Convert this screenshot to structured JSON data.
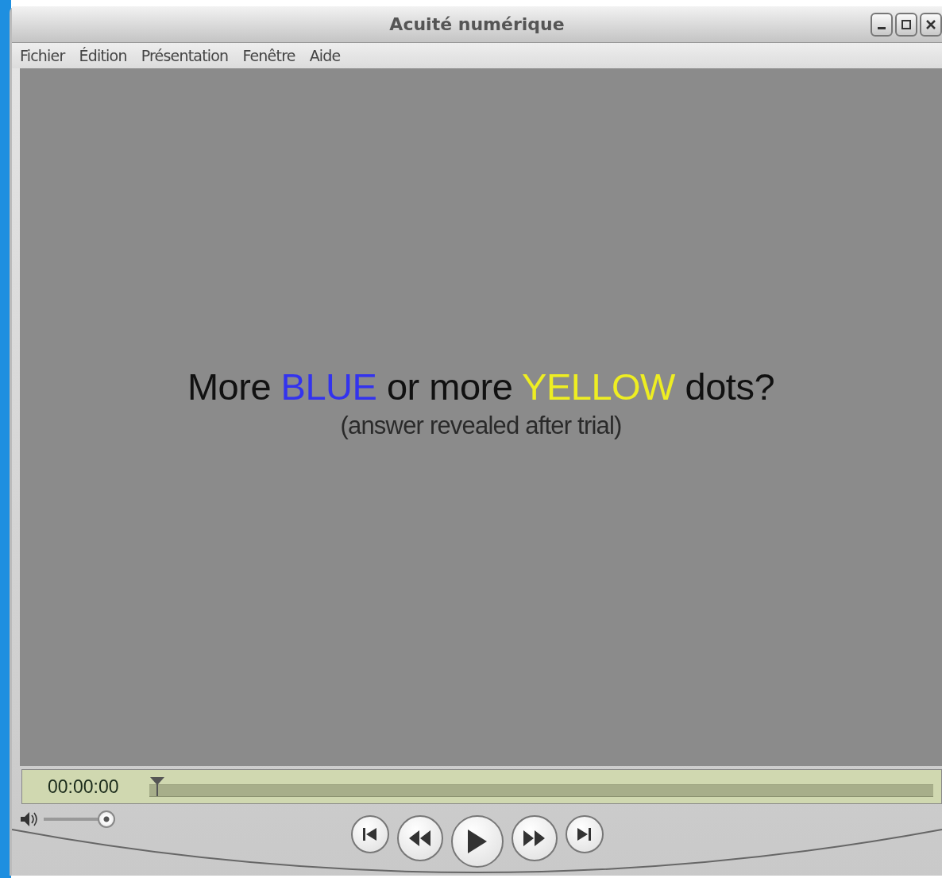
{
  "window": {
    "title": "Acuité numérique"
  },
  "menu": [
    {
      "label": "Fichier"
    },
    {
      "label": "Édition"
    },
    {
      "label": "Présentation"
    },
    {
      "label": "Fenêtre"
    },
    {
      "label": "Aide"
    }
  ],
  "video": {
    "headline": [
      {
        "text": "More ",
        "color": "#111111"
      },
      {
        "text": "BLUE",
        "color": "#3333ee"
      },
      {
        "text": " or more ",
        "color": "#111111"
      },
      {
        "text": "YELLOW",
        "color": "#eeee22"
      },
      {
        "text": " dots?",
        "color": "#111111"
      }
    ],
    "subtitle": "(answer revealed after trial)"
  },
  "timeline": {
    "time": "00:00:00",
    "level": 0
  },
  "volume": {
    "level": 1
  },
  "controls": [
    {
      "kind": "start"
    },
    {
      "kind": "rewind"
    },
    {
      "kind": "play"
    },
    {
      "kind": "forward"
    },
    {
      "kind": "end"
    }
  ]
}
